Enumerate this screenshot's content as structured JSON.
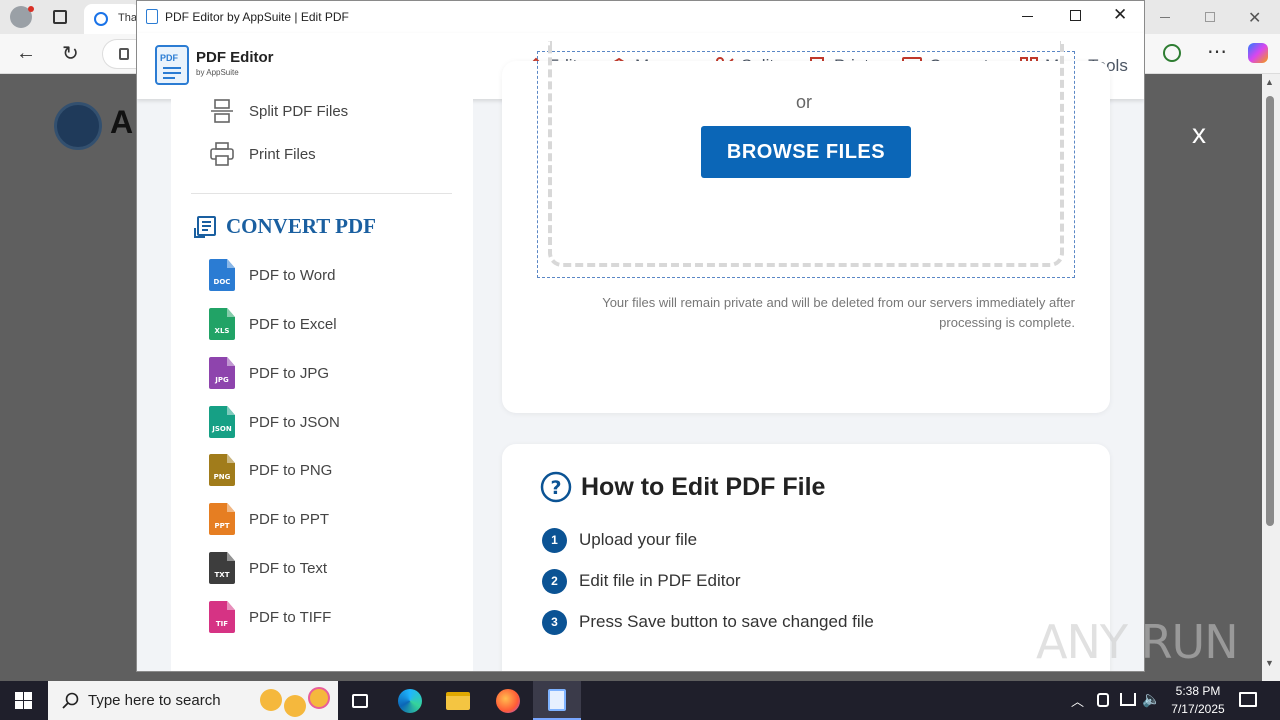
{
  "browser": {
    "tab_title": "Tha",
    "overlay_close": "x",
    "bg_logo_letter": "A"
  },
  "window": {
    "title": "PDF Editor by AppSuite | Edit PDF",
    "controls": {
      "minimize": "minimize-icon",
      "maximize": "maximize-icon",
      "close": "close-icon"
    }
  },
  "header": {
    "logo_title": "PDF Editor",
    "logo_subtitle": "by AppSuite",
    "logo_badge": "PDF",
    "nav": [
      {
        "label": "Edit",
        "icon": "pencil-icon"
      },
      {
        "label": "Merge",
        "icon": "layers-icon"
      },
      {
        "label": "Split",
        "icon": "scissors-icon"
      },
      {
        "label": "Print",
        "icon": "printer-icon"
      },
      {
        "label": "Convert",
        "icon": "convert-icon"
      },
      {
        "label": "More Tools",
        "icon": "grid-icon"
      }
    ],
    "accent_color": "#c0392b"
  },
  "sidebar": {
    "tools": [
      {
        "label": "Split PDF Files",
        "icon": "split-icon"
      },
      {
        "label": "Print Files",
        "icon": "printer-icon"
      }
    ],
    "convert_heading": "CONVERT PDF",
    "convert_items": [
      {
        "label": "PDF to Word",
        "tag": "DOC",
        "color": "#2b7cd3"
      },
      {
        "label": "PDF to Excel",
        "tag": "XLS",
        "color": "#21a366"
      },
      {
        "label": "PDF to JPG",
        "tag": "JPG",
        "color": "#8e44ad"
      },
      {
        "label": "PDF to JSON",
        "tag": "JSON",
        "color": "#16a085"
      },
      {
        "label": "PDF to PNG",
        "tag": "PNG",
        "color": "#a17c1b"
      },
      {
        "label": "PDF to PPT",
        "tag": "PPT",
        "color": "#e67e22"
      },
      {
        "label": "PDF to Text",
        "tag": "TXT",
        "color": "#3d3d3d"
      },
      {
        "label": "PDF to TIFF",
        "tag": "TIF",
        "color": "#d63384"
      }
    ]
  },
  "upload": {
    "or_text": "or",
    "browse_label": "BROWSE FILES",
    "privacy_line1": "Your files will remain private and will be deleted from our servers immediately after",
    "privacy_line2": "processing is complete."
  },
  "howto": {
    "title": "How to Edit PDF File",
    "steps": [
      {
        "num": "1",
        "text": "Upload your file"
      },
      {
        "num": "2",
        "text": "Edit file in PDF Editor"
      },
      {
        "num": "3",
        "text": "Press Save button to save changed file"
      }
    ]
  },
  "taskbar": {
    "search_placeholder": "Type here to search",
    "time": "5:38 PM",
    "date": "7/17/2025"
  },
  "watermark": "ANY RUN",
  "colors": {
    "brand_blue": "#0b5394",
    "browse_blue": "#0b66b7",
    "heading_blue": "#1a5fa0"
  }
}
